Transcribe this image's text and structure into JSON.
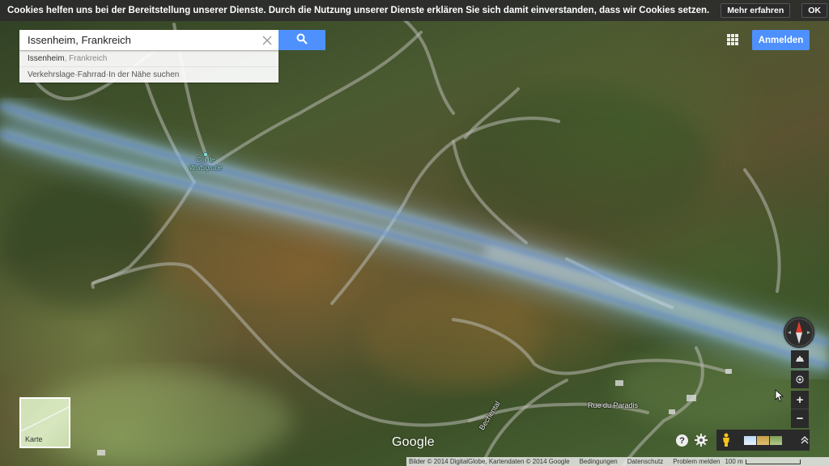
{
  "cookie_bar": {
    "message": "Cookies helfen uns bei der Bereitstellung unserer Dienste. Durch die Nutzung unserer Dienste erklären Sie sich damit einverstanden, dass wir Cookies setzen.",
    "learn_more": "Mehr erfahren",
    "ok": "OK"
  },
  "search": {
    "value": "Issenheim, Frankreich",
    "suggestion_primary": "Issenheim",
    "suggestion_secondary": ", Frankreich",
    "links": [
      "Verkehrslage",
      "Fahrrad",
      "In der Nähe suchen"
    ],
    "separator": " · "
  },
  "header": {
    "signin": "Anmelden"
  },
  "map_labels": {
    "pass_line1": "Col de",
    "pass_line2": "Wolfsgrube",
    "road_paradis": "Rue du Paradis",
    "road_bechental": "Bechental"
  },
  "controls": {
    "zoom_in": "+",
    "zoom_out": "−",
    "help": "?"
  },
  "map_type": {
    "label": "Karte"
  },
  "branding": {
    "logo": "Google"
  },
  "footer": {
    "attribution": "Bilder © 2014 DigitalGlobe, Kartendaten © 2014 Google",
    "terms": "Bedingungen",
    "privacy": "Datenschutz",
    "report": "Problem melden",
    "scale": "100 m"
  },
  "colors": {
    "accent_blue": "#4d90fe",
    "dark_control": "#2a2a2a",
    "glow": "#9fd0ff"
  },
  "icons": [
    "search-icon",
    "clear-icon",
    "apps-icon",
    "compass-icon",
    "tilt-icon",
    "location-icon",
    "gear-icon",
    "help-icon",
    "pegman-icon",
    "expand-icon"
  ]
}
